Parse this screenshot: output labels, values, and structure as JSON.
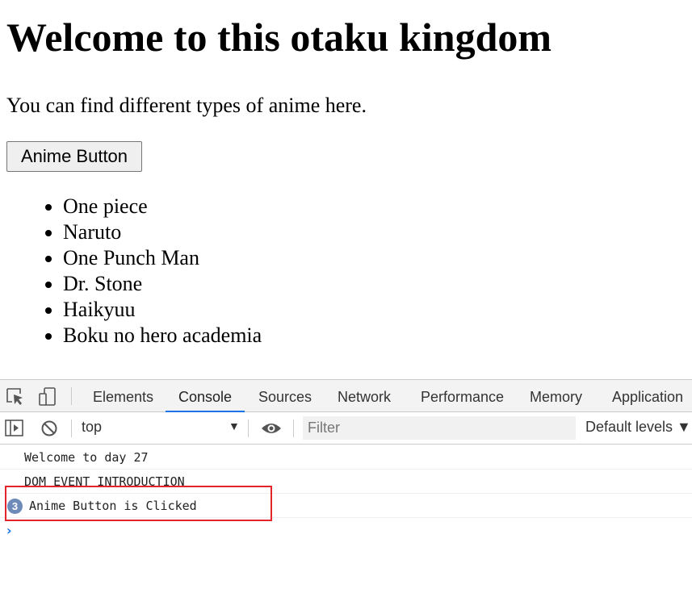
{
  "page": {
    "heading": "Welcome to this otaku kingdom",
    "intro": "You can find different types of anime here.",
    "button_label": "Anime Button",
    "anime_list": [
      "One piece",
      "Naruto",
      "One Punch Man",
      "Dr. Stone",
      "Haikyuu",
      "Boku no hero academia"
    ]
  },
  "devtools": {
    "tabs": [
      {
        "label": "Elements",
        "active": false
      },
      {
        "label": "Console",
        "active": true
      },
      {
        "label": "Sources",
        "active": false
      },
      {
        "label": "Network",
        "active": false
      },
      {
        "label": "Performance",
        "active": false
      },
      {
        "label": "Memory",
        "active": false
      },
      {
        "label": "Application",
        "active": false
      }
    ],
    "toolbar": {
      "context": "top",
      "context_arrow": "▼",
      "filter_placeholder": "Filter",
      "levels": "Default levels ▼"
    },
    "console": [
      {
        "text": "Welcome to day 27"
      },
      {
        "text": "DOM EVENT INTRODUCTION"
      },
      {
        "text": "Anime Button is Clicked",
        "count": "3"
      }
    ],
    "prompt_symbol": "›",
    "accent_color": "#1a73e8",
    "highlight_color": "#e3242b"
  }
}
